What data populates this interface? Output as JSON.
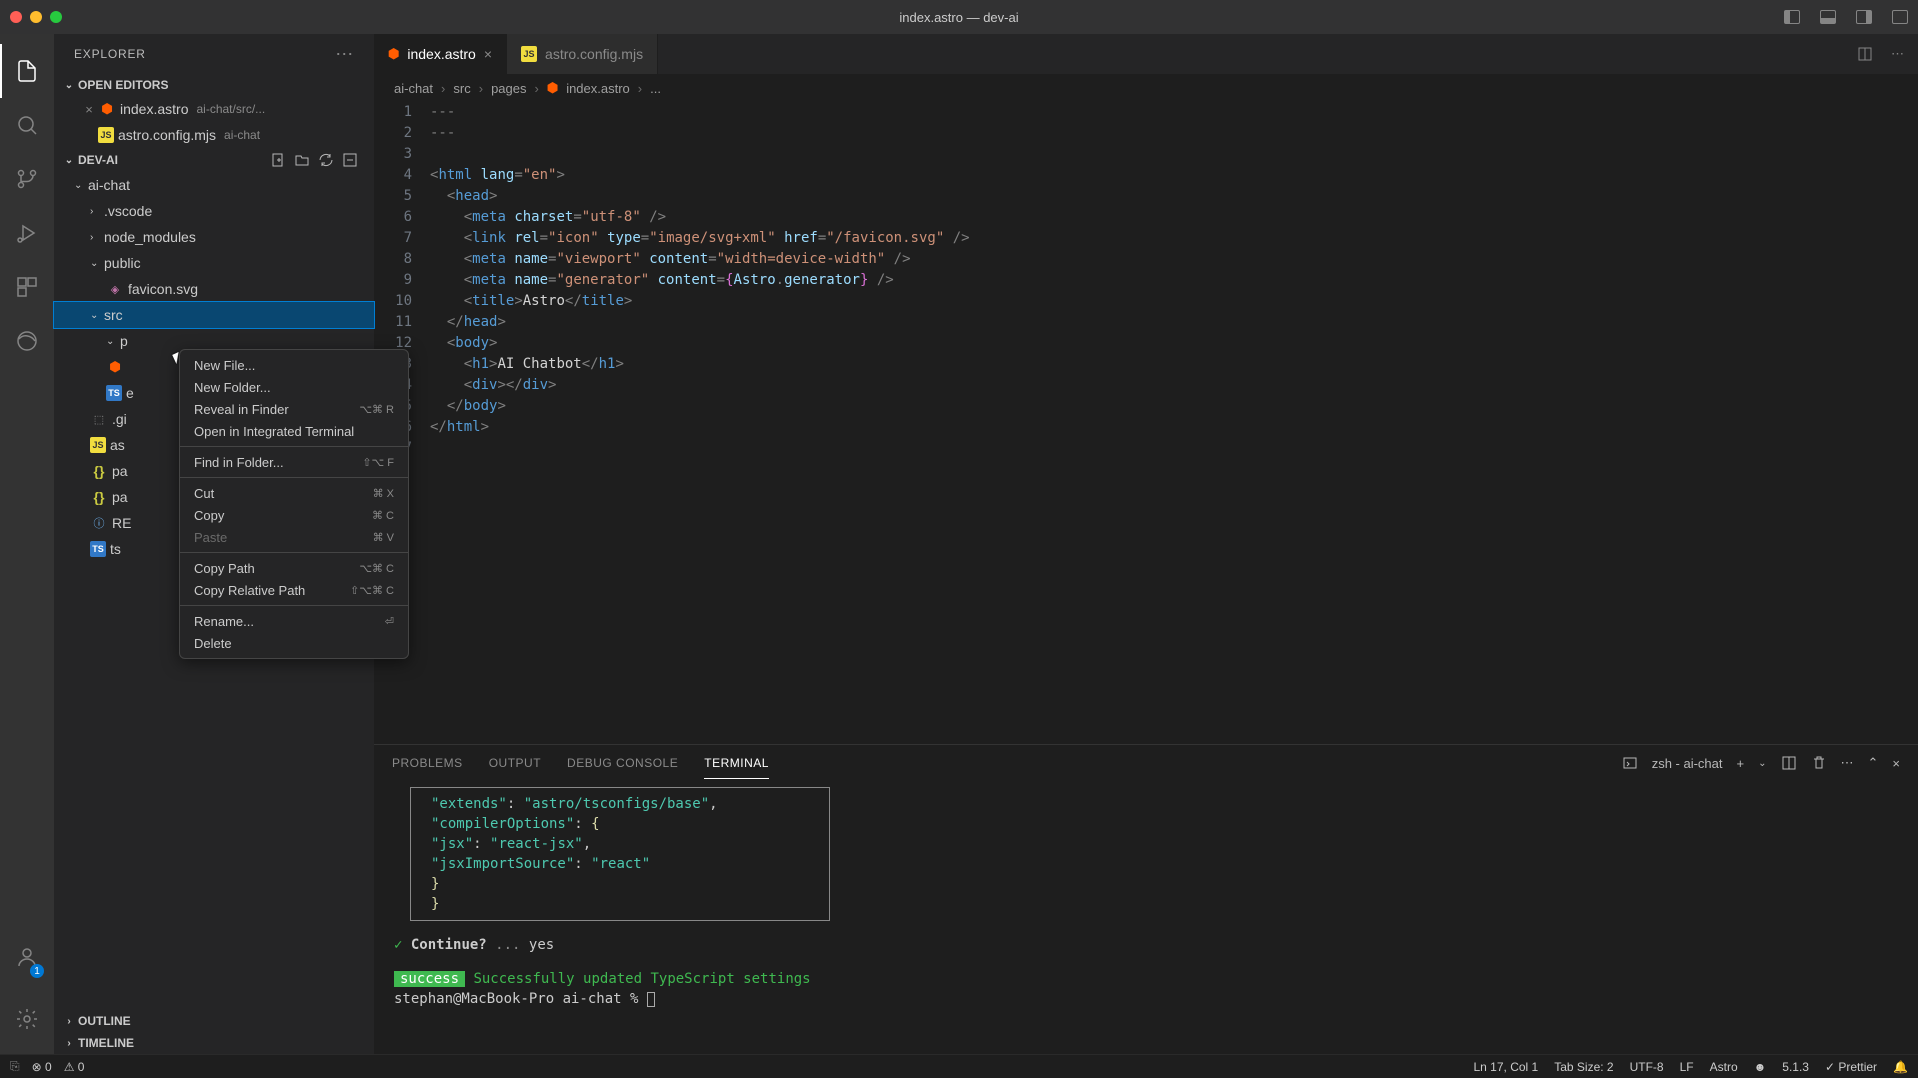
{
  "titlebar": {
    "title": "index.astro — dev-ai"
  },
  "sidebar": {
    "header": "EXPLORER",
    "open_editors_label": "OPEN EDITORS",
    "open_editors": [
      {
        "name": "index.astro",
        "detail": "ai-chat/src/...",
        "icon": "astro",
        "closable": true
      },
      {
        "name": "astro.config.mjs",
        "detail": "ai-chat",
        "icon": "js",
        "closable": false
      }
    ],
    "workspace_label": "DEV-AI",
    "tree": {
      "ai_chat": "ai-chat",
      "vscode": ".vscode",
      "node_modules": "node_modules",
      "public": "public",
      "favicon": "favicon.svg",
      "src": "src",
      "p_partial": "p",
      "e_partial": "e",
      "gi_partial": ".gi",
      "as_partial": "as",
      "pa_partial": "pa",
      "pa2_partial": "pa",
      "re_partial": "RE",
      "ts_partial": "ts"
    },
    "outline_label": "OUTLINE",
    "timeline_label": "TIMELINE"
  },
  "context_menu": {
    "new_file": "New File...",
    "new_folder": "New Folder...",
    "reveal": "Reveal in Finder",
    "reveal_sc": "⌥⌘ R",
    "terminal": "Open in Integrated Terminal",
    "find": "Find in Folder...",
    "find_sc": "⇧⌥ F",
    "cut": "Cut",
    "cut_sc": "⌘ X",
    "copy": "Copy",
    "copy_sc": "⌘ C",
    "paste": "Paste",
    "paste_sc": "⌘ V",
    "copy_path": "Copy Path",
    "copy_path_sc": "⌥⌘ C",
    "copy_rel": "Copy Relative Path",
    "copy_rel_sc": "⇧⌥⌘ C",
    "rename": "Rename...",
    "rename_sc": "⏎",
    "delete": "Delete"
  },
  "tabs": {
    "t1": "index.astro",
    "t2": "astro.config.mjs"
  },
  "breadcrumb": {
    "b1": "ai-chat",
    "b2": "src",
    "b3": "pages",
    "b4": "index.astro",
    "b5": "..."
  },
  "line_numbers": [
    "1",
    "2",
    "3",
    "4",
    "5",
    "6",
    "7",
    "8",
    "9",
    "10",
    "11",
    "12",
    "13",
    "14",
    "15",
    "16",
    "17"
  ],
  "panel": {
    "problems": "PROBLEMS",
    "output": "OUTPUT",
    "debug": "DEBUG CONSOLE",
    "terminal": "TERMINAL",
    "shell": "zsh - ai-chat"
  },
  "terminal": {
    "extends_key": "\"extends\"",
    "extends_val": "\"astro/tsconfigs/base\"",
    "compiler_key": "\"compilerOptions\"",
    "jsx_key": "\"jsx\"",
    "jsx_val": "\"react-jsx\"",
    "src_key": "\"jsxImportSource\"",
    "src_val": "\"react\"",
    "check": "✓",
    "continue": "Continue?",
    "ellipsis": "...",
    "yes": "yes",
    "success": "success",
    "success_msg": "Successfully updated TypeScript settings",
    "prompt": "stephan@MacBook-Pro ai-chat % "
  },
  "status": {
    "errors": "0",
    "warnings": "0",
    "position": "Ln 17, Col 1",
    "tabsize": "Tab Size: 2",
    "encoding": "UTF-8",
    "eol": "LF",
    "lang": "Astro",
    "version": "5.1.3",
    "prettier": "Prettier"
  },
  "code": {
    "l1": "---",
    "l2": "---",
    "l3": "",
    "l4_html": "html",
    "l4_lang": "lang",
    "l4_en": "\"en\"",
    "l5_head": "head",
    "l6_meta": "meta",
    "l6_charset": "charset",
    "l6_utf": "\"utf-8\"",
    "l7_link": "link",
    "l7_rel": "rel",
    "l7_icon": "\"icon\"",
    "l7_type": "type",
    "l7_svg": "\"image/svg+xml\"",
    "l7_href": "href",
    "l7_path": "\"/favicon.svg\"",
    "l8_name": "name",
    "l8_vp": "\"viewport\"",
    "l8_content": "content",
    "l8_width": "\"width=device-width\"",
    "l9_gen": "\"generator\"",
    "l9_astro": "Astro",
    "l9_gen2": "generator",
    "l10_title": "title",
    "l10_astro": "Astro",
    "l12_body": "body",
    "l13_h1": "h1",
    "l13_text": "AI Chatbot",
    "l14_div": "div"
  }
}
